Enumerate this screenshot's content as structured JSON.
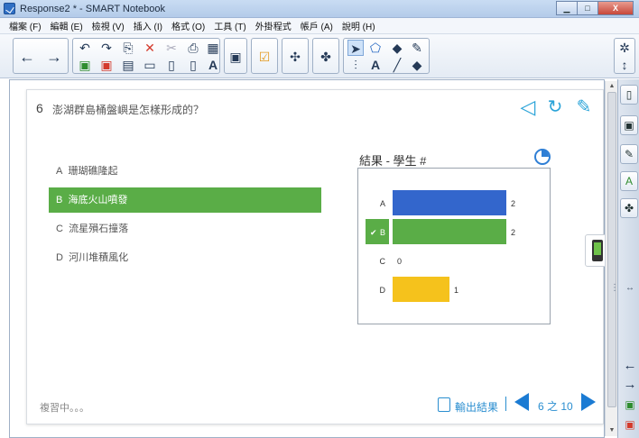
{
  "window": {
    "title": "Response2 * - SMART Notebook",
    "min_label": "▁",
    "max_label": "□",
    "close_label": "X"
  },
  "menu": [
    "檔案 (F)",
    "編輯 (E)",
    "檢視 (V)",
    "插入 (I)",
    "格式 (O)",
    "工具 (T)",
    "外掛程式",
    "帳戶 (A)",
    "說明 (H)"
  ],
  "question": {
    "number": "6",
    "text": "澎湖群島桶盤嶼是怎樣形成的？"
  },
  "choices": [
    {
      "letter": "A",
      "text": "珊瑚礁隆起",
      "selected": false
    },
    {
      "letter": "B",
      "text": "海底火山噴發",
      "selected": true
    },
    {
      "letter": "C",
      "text": "流星殞石撞落",
      "selected": false
    },
    {
      "letter": "D",
      "text": "河川堆積風化",
      "selected": false
    }
  ],
  "results_title": "結果 - 學生 #",
  "chart_data": {
    "type": "bar",
    "orientation": "horizontal",
    "categories": [
      "A",
      "B",
      "C",
      "D"
    ],
    "values": [
      2,
      2,
      0,
      1
    ],
    "colors": [
      "#3366cc",
      "#5aad47",
      "#999999",
      "#f5c21c"
    ],
    "correct": "B",
    "xlim": [
      0,
      2
    ]
  },
  "footer": {
    "status": "複習中。。。",
    "export_label": "輸出結果",
    "page_indicator": "6 之 10"
  },
  "colors": {
    "selected_choice": "#5aad47",
    "accent": "#2a8ed0",
    "nav_arrow": "#1b7bd3"
  }
}
